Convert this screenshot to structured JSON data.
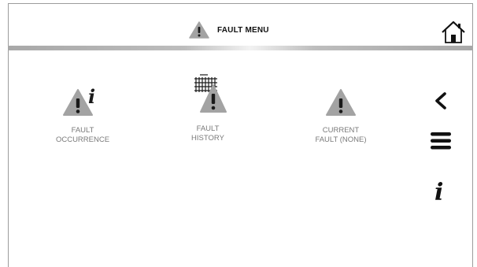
{
  "header": {
    "title": "FAULT MENU",
    "icon": "warning-triangle-icon"
  },
  "nav": {
    "home_icon": "home-icon",
    "back_icon": "chevron-left-icon",
    "menu_icon": "hamburger-menu-icon",
    "info_icon": "info-icon"
  },
  "tiles": [
    {
      "line1": "FAULT",
      "line2": "OCCURRENCE",
      "icon": "warning-info-icon"
    },
    {
      "line1": "FAULT",
      "line2": "HISTORY",
      "icon": "warning-calendar-icon"
    },
    {
      "line1": "CURRENT",
      "line2": "FAULT (NONE)",
      "icon": "warning-triangle-icon"
    }
  ],
  "colors": {
    "icon_gray": "#a3a3a3",
    "icon_dark": "#1a1a1a",
    "label_gray": "#7a7a7a"
  }
}
